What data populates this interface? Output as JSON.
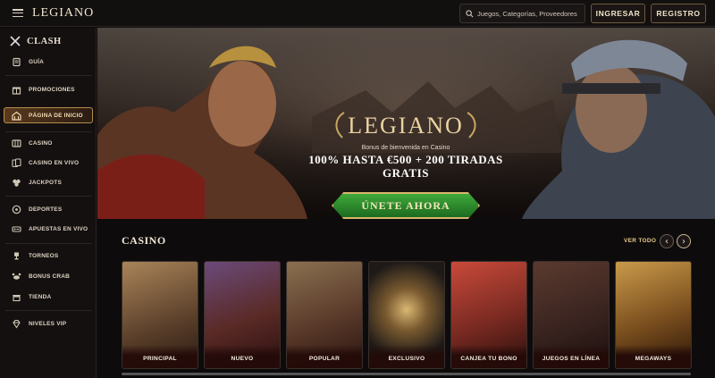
{
  "header": {
    "logo": "LEGIANO",
    "search_placeholder": "Juegos, Categorías, Proveedores",
    "login_label": "INGRESAR",
    "register_label": "REGISTRO"
  },
  "sidebar": {
    "clash_label": "CLASH",
    "items": [
      {
        "label": "GUÍA",
        "icon": "scroll-icon"
      },
      {
        "label": "PROMOCIONES",
        "icon": "gift-icon"
      },
      {
        "label": "PÁGINA DE INICIO",
        "icon": "home-icon",
        "active": true
      },
      {
        "label": "CASINO",
        "icon": "casino-icon"
      },
      {
        "label": "CASINO EN VIVO",
        "icon": "cards-icon"
      },
      {
        "label": "JACKPOTS",
        "icon": "jackpot-icon"
      },
      {
        "label": "DEPORTES",
        "icon": "ball-icon"
      },
      {
        "label": "APUESTAS EN VIVO",
        "icon": "live-bet-icon"
      },
      {
        "label": "TORNEOS",
        "icon": "trophy-icon"
      },
      {
        "label": "BONUS CRAB",
        "icon": "crab-icon"
      },
      {
        "label": "TIENDA",
        "icon": "shop-icon"
      },
      {
        "label": "NIVELES VIP",
        "icon": "diamond-icon"
      }
    ]
  },
  "hero": {
    "logo": "LEGIANO",
    "subtitle": "Bonus de bienvenida en Casino",
    "title": "100% HASTA €500 + 200 TIRADAS GRATIS",
    "cta": "ÚNETE AHORA"
  },
  "casino": {
    "title": "CASINO",
    "view_all": "VER TODO",
    "prev_icon": "chevron-left-icon",
    "next_icon": "chevron-right-icon",
    "cards": [
      {
        "label": "PRINCIPAL",
        "color": "#6b5338"
      },
      {
        "label": "NUEVO",
        "color": "#4a2d2a"
      },
      {
        "label": "POPULAR",
        "color": "#5a4a38"
      },
      {
        "label": "EXCLUSIVO",
        "color": "#2e2a27"
      },
      {
        "label": "CANJEA TU BONO",
        "color": "#6a2b24"
      },
      {
        "label": "JUEGOS EN LÍNEA",
        "color": "#3a2a24"
      },
      {
        "label": "MEGAWAYS",
        "color": "#5e4322"
      }
    ]
  },
  "colors": {
    "accent_gold": "#d8b66e",
    "cta_green": "#2e8a2c",
    "background": "#0d0b0b"
  }
}
